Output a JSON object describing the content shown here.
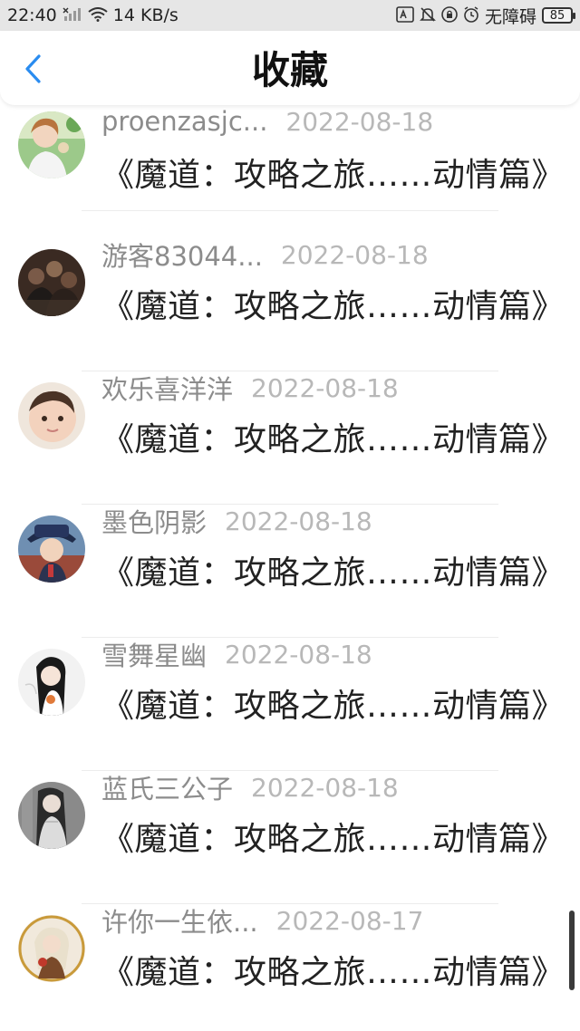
{
  "status_bar": {
    "time": "22:40",
    "network_speed": "14 KB/s",
    "sim_status": "无障碍",
    "battery": "85",
    "icons": [
      "no-signal-icon",
      "wifi-icon",
      "translate-icon",
      "mute-icon",
      "lock-rotation-icon",
      "alarm-icon"
    ]
  },
  "header": {
    "title": "收藏",
    "back_icon": "chevron-left-icon",
    "accent_color": "#2a8cf0"
  },
  "items": [
    {
      "username": "proenzasjc...",
      "date": "2022-08-18",
      "title": "《魔道：攻略之旅……动情篇》",
      "avatar": "avatar-girl-in-garden"
    },
    {
      "username": "游客83044...",
      "date": "2022-08-18",
      "title": "《魔道：攻略之旅……动情篇》",
      "avatar": "avatar-group-dark"
    },
    {
      "username": "欢乐喜洋洋",
      "date": "2022-08-18",
      "title": "《魔道：攻略之旅……动情篇》",
      "avatar": "avatar-baby"
    },
    {
      "username": "墨色阴影",
      "date": "2022-08-18",
      "title": "《魔道：攻略之旅……动情篇》",
      "avatar": "avatar-anime-hat"
    },
    {
      "username": "雪舞星幽",
      "date": "2022-08-18",
      "title": "《魔道：攻略之旅……动情篇》",
      "avatar": "avatar-anime-white"
    },
    {
      "username": "蓝氏三公子",
      "date": "2022-08-18",
      "title": "《魔道：攻略之旅……动情篇》",
      "avatar": "avatar-anime-grey"
    },
    {
      "username": "许你一生依...",
      "date": "2022-08-17",
      "title": "《魔道：攻略之旅……动情篇》",
      "avatar": "avatar-anime-gold"
    }
  ]
}
